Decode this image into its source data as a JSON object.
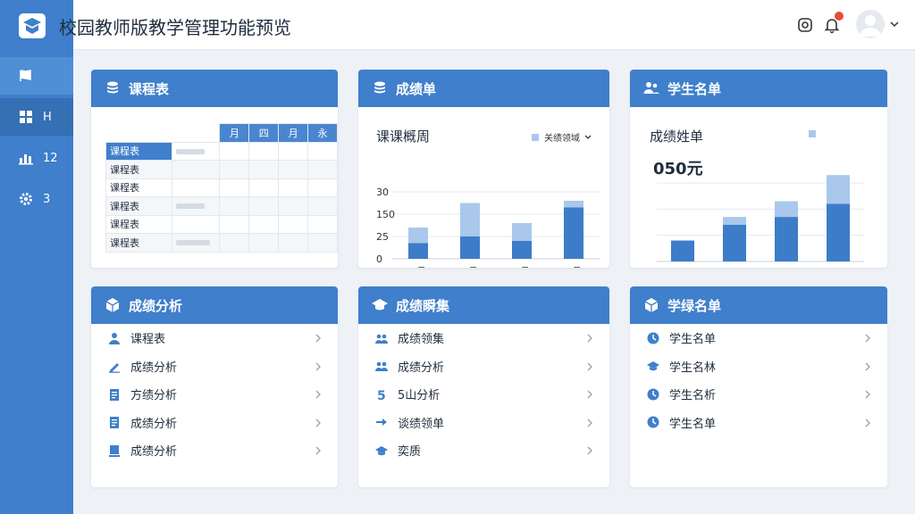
{
  "app": {
    "title": "校园教师版教学管理功能预览"
  },
  "colors": {
    "primary": "#3f7fcb",
    "bar_dark": "#3d7cc9",
    "bar_light": "#a9c8ec",
    "badge": "#e74c3c"
  },
  "sidebar": {
    "items": [
      {
        "icon": "flag-icon",
        "label": ""
      },
      {
        "icon": "grid-icon",
        "label": "H"
      },
      {
        "icon": "chart-icon",
        "label": "12"
      },
      {
        "icon": "gear-icon",
        "label": "3"
      }
    ]
  },
  "header": {
    "icons": [
      "camera-icon",
      "bell-icon",
      "avatar",
      "chevron-down-icon"
    ]
  },
  "cards": {
    "timetable": {
      "title": "课程表",
      "columns": [
        "月",
        "四",
        "月",
        "永"
      ],
      "rows": [
        "课程表",
        "课程表",
        "课程表",
        "课程表",
        "课程表",
        "课程表"
      ]
    },
    "grades": {
      "title": "成绩单",
      "chart_title": "课课概周",
      "legend": "关绩领域",
      "y_ticks": [
        "30",
        "150",
        "25",
        "0"
      ],
      "categories": [
        "1月",
        "2月",
        "4月",
        "6月"
      ]
    },
    "students": {
      "title": "学生名单",
      "chart_title": "成绩姓单",
      "value": "050元",
      "categories": [
        "1月",
        "2月",
        "6月",
        "7月"
      ]
    },
    "analysis": {
      "title": "成绩分析",
      "items": [
        {
          "icon": "user-icon",
          "label": "课程表"
        },
        {
          "icon": "pen-icon",
          "label": "成绩分析"
        },
        {
          "icon": "document-icon",
          "label": "方绩分析"
        },
        {
          "icon": "document-icon",
          "label": "成绩分析"
        },
        {
          "icon": "book-icon",
          "label": "成绩分析"
        }
      ]
    },
    "collection": {
      "title": "成绩瞬集",
      "items": [
        {
          "icon": "group-icon",
          "label": "成绩领集"
        },
        {
          "icon": "group-icon",
          "label": "成绩分析"
        },
        {
          "icon": "number-icon",
          "label": "5山分析"
        },
        {
          "icon": "arrow-right-icon",
          "label": "谈绩领单"
        },
        {
          "icon": "graduation-cap-icon",
          "label": "奕质"
        }
      ]
    },
    "roster": {
      "title": "学绿名单",
      "items": [
        {
          "icon": "clock-icon",
          "label": "学生名单"
        },
        {
          "icon": "graduation-cap-icon",
          "label": "学生名林"
        },
        {
          "icon": "clock-icon",
          "label": "学生名析"
        },
        {
          "icon": "clock-icon",
          "label": "学生名单"
        }
      ]
    }
  },
  "chart_data": [
    {
      "type": "bar",
      "title": "课课概周",
      "categories": [
        "1月",
        "2月",
        "4月",
        "6月"
      ],
      "y_ticks": [
        "30",
        "150",
        "25",
        "0"
      ],
      "series": [
        {
          "name": "",
          "values": [
            7,
            10,
            8,
            23
          ]
        },
        {
          "name": "关绩领域",
          "values": [
            7,
            15,
            8,
            3
          ]
        }
      ]
    },
    {
      "type": "bar",
      "title": "成绩姓单",
      "categories": [
        "1月",
        "2月",
        "6月",
        "7月"
      ],
      "series": [
        {
          "name": "",
          "values": [
            8,
            14,
            17,
            22
          ]
        },
        {
          "name": "",
          "values": [
            0,
            3,
            6,
            11
          ]
        }
      ]
    }
  ]
}
